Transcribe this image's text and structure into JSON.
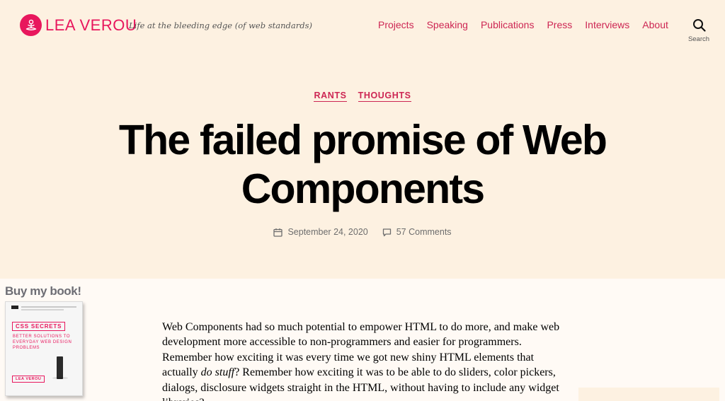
{
  "header": {
    "site_title": "LEA VEROU",
    "tagline": "Life at the bleeding edge (of web standards)",
    "nav": [
      "Projects",
      "Speaking",
      "Publications",
      "Press",
      "Interviews",
      "About"
    ],
    "search_label": "Search",
    "logo_icon": "meditating-figure-icon"
  },
  "post": {
    "categories": [
      "RANTS",
      "THOUGHTS"
    ],
    "title": "The failed promise of Web Components",
    "date": "September 24, 2020",
    "comments": "57 Comments"
  },
  "sidebar": {
    "buy_title": "Buy my book!",
    "book": {
      "title": "CSS SECRETS",
      "subtitle": "BETTER SOLUTIONS TO EVERYDAY WEB DESIGN PROBLEMS",
      "author": "LEA VEROU"
    }
  },
  "content": {
    "p1_before": "Web Components had so much potential to empower HTML to do more, and make web development more accessible to non-programmers and easier for programmers. Remember how exciting it was every time we got new shiny HTML elements that actually ",
    "p1_em": "do stuff",
    "p1_after": "? Remember how exciting it was to be able to do sliders, color pickers, dialogs, disclosure widgets straight in the HTML, without having to include any widget libraries?"
  },
  "colors": {
    "accent": "#cd2653",
    "brand": "#e8175d",
    "header_bg": "#fdf1e1",
    "body_bg": "#fffaf5"
  }
}
